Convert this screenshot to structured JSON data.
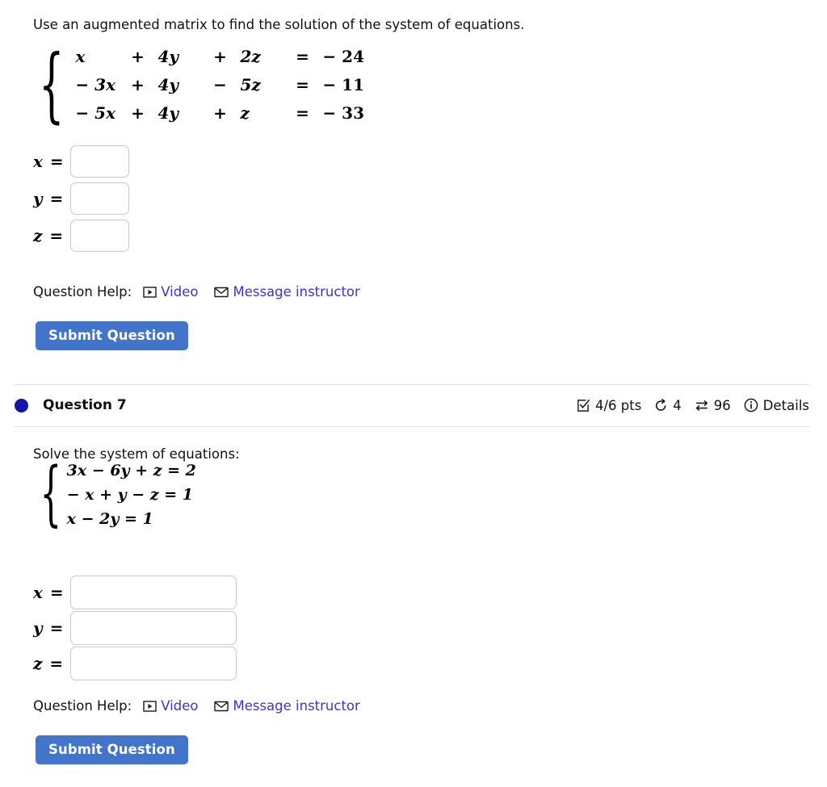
{
  "question6": {
    "prompt": "Use an augmented matrix to find the solution of the system of equations.",
    "system": {
      "rows": [
        {
          "term1": "x",
          "op1": "+",
          "term2": "4y",
          "op2": "+",
          "term3": "2z",
          "eq": "=",
          "rhs": "− 24"
        },
        {
          "term1": "− 3x",
          "op1": "+",
          "term2": "4y",
          "op2": "−",
          "term3": "5z",
          "eq": "=",
          "rhs": "− 11"
        },
        {
          "term1": "− 5x",
          "op1": "+",
          "term2": "4y",
          "op2": "+",
          "term3": "z",
          "eq": "=",
          "rhs": "− 33"
        }
      ]
    },
    "answers": [
      {
        "label": "x =",
        "value": ""
      },
      {
        "label": "y =",
        "value": ""
      },
      {
        "label": "z =",
        "value": ""
      }
    ],
    "help": {
      "label": "Question Help:",
      "video_label": "Video",
      "video_icon": "video-icon",
      "message_label": "Message instructor",
      "message_icon": "envelope-icon"
    },
    "submit_label": "Submit Question"
  },
  "question7": {
    "header": {
      "title": "Question 7",
      "status_dot": "unanswered-dot",
      "score": "4/6 pts",
      "score_icon": "checked-box-icon",
      "attempts": "4",
      "attempts_icon": "undo-arrow-icon",
      "retries": "96",
      "retries_icon": "swap-arrows-icon",
      "details_label": "Details",
      "details_icon": "info-circle-icon"
    },
    "prompt": "Solve the system of equations:",
    "system": {
      "lines": [
        "3x − 6y + z = 2",
        "− x + y − z = 1",
        "x − 2y = 1"
      ]
    },
    "answers": [
      {
        "label": "x =",
        "value": ""
      },
      {
        "label": "y =",
        "value": ""
      },
      {
        "label": "z =",
        "value": ""
      }
    ],
    "help": {
      "label": "Question Help:",
      "video_label": "Video",
      "video_icon": "video-icon",
      "message_label": "Message instructor",
      "message_icon": "envelope-icon"
    },
    "submit_label": "Submit Question"
  },
  "colors": {
    "link": "#3b36c4",
    "submit_button": "#4274c9",
    "status_dot": "#1414a8",
    "divider": "#e0e0e0",
    "input_border": "#c9c9c9"
  },
  "glyphs": {
    "brace": "{"
  }
}
